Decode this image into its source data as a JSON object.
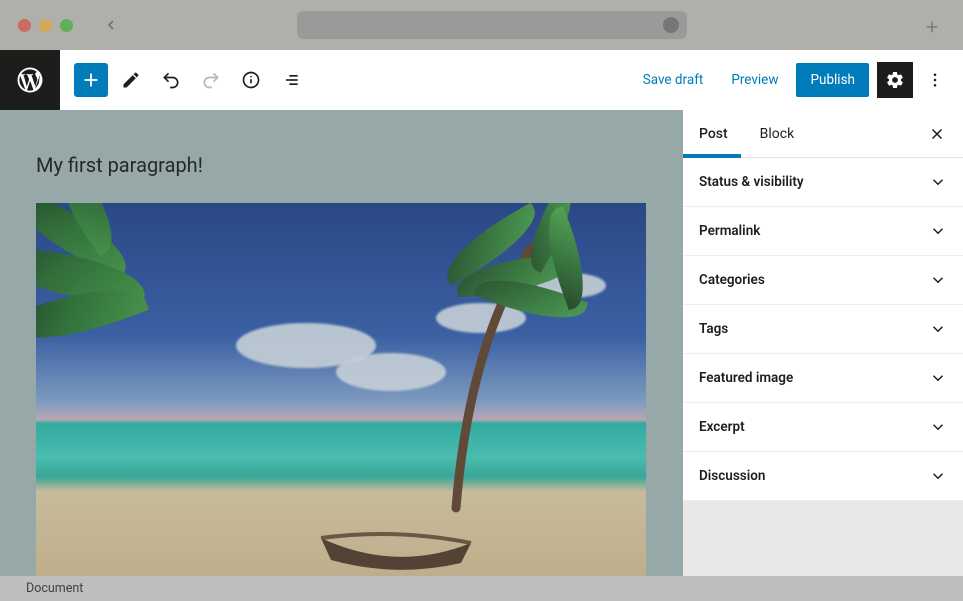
{
  "browser": {},
  "toolbar": {
    "save_draft": "Save draft",
    "preview": "Preview",
    "publish": "Publish"
  },
  "content": {
    "paragraph": "My first paragraph!"
  },
  "sidebar": {
    "tabs": {
      "post": "Post",
      "block": "Block"
    },
    "sections": [
      "Status & visibility",
      "Permalink",
      "Categories",
      "Tags",
      "Featured image",
      "Excerpt",
      "Discussion"
    ]
  },
  "status": {
    "breadcrumb": "Document"
  }
}
